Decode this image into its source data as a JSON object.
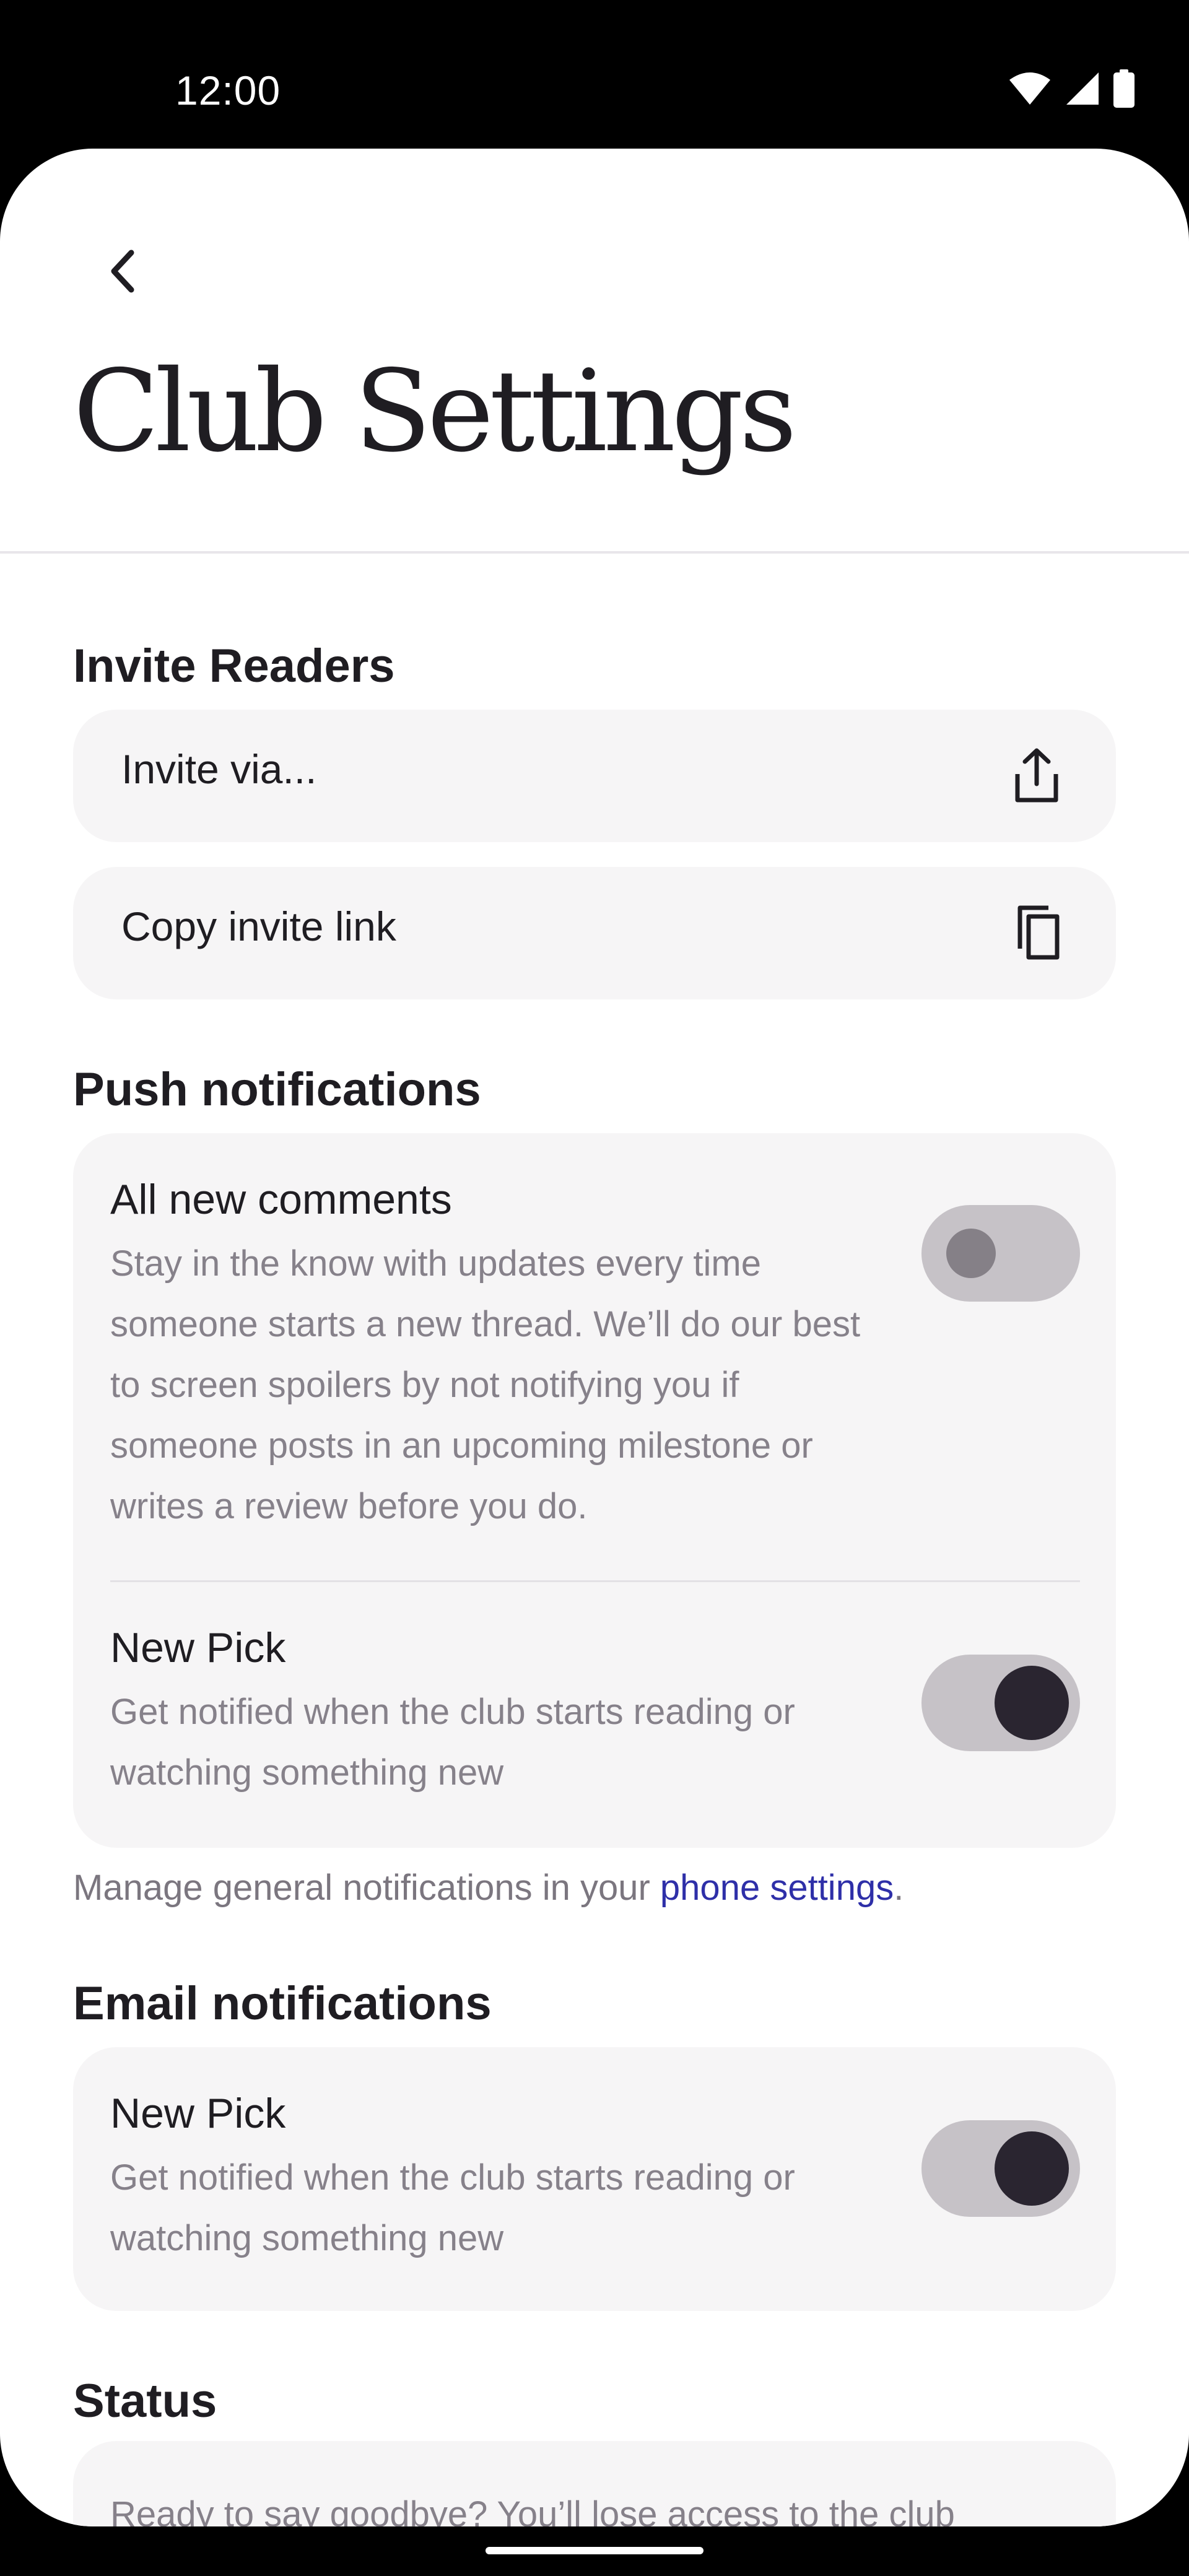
{
  "status_bar": {
    "time": "12:00"
  },
  "header": {
    "title": "Club Settings"
  },
  "invite": {
    "section_title": "Invite Readers",
    "invite_via_label": "Invite via...",
    "copy_link_label": "Copy invite link"
  },
  "push": {
    "section_title": "Push notifications",
    "items": [
      {
        "title": "All new comments",
        "description": "Stay in the know with updates every time someone starts a new thread. We’ll do our best to screen spoilers by not notifying you if someone posts in an upcoming milestone or writes a review before you do.",
        "enabled": false
      },
      {
        "title": "New Pick",
        "description": "Get notified when the club starts reading or watching something new",
        "enabled": true
      }
    ],
    "footnote_prefix": "Manage general notifications in your ",
    "footnote_link": "phone settings",
    "footnote_suffix": "."
  },
  "email": {
    "section_title": "Email notifications",
    "items": [
      {
        "title": "New Pick",
        "description": "Get notified when the club starts reading or watching something new",
        "enabled": true
      }
    ]
  },
  "status": {
    "section_title": "Status",
    "description": "Ready to say goodbye? You’ll lose access to the club"
  },
  "colors": {
    "accent_link": "#2e2fa8",
    "toggle_track": "#c6c2c7",
    "toggle_knob_on": "#2a2530",
    "card_bg": "#f6f5f6"
  }
}
